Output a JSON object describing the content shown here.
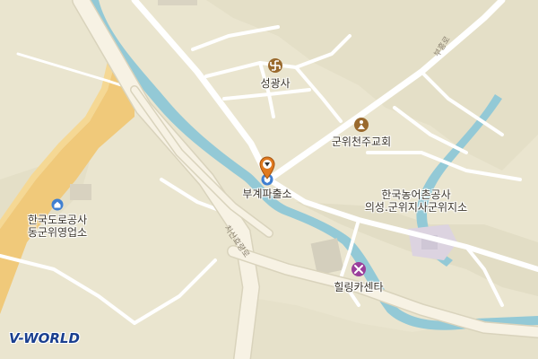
{
  "map": {
    "brand": "V-WORLD",
    "colors": {
      "land": "#eae5cf",
      "land_alt": "#e5e0c8",
      "road": "#ffffff",
      "road_edge": "#d9d3bc",
      "major_road": "#f6f1e3",
      "expressway": "#f0c56a",
      "river": "#93c9d6",
      "hill": "#ddd8c0",
      "building": "#d6d1c1",
      "facility_area": "#d9d2e2"
    },
    "places": [
      {
        "label": "성광사",
        "icon": "buddhist-temple-icon"
      },
      {
        "label": "군위천주교회",
        "icon": "church-icon"
      },
      {
        "label": "부계파출소",
        "icon": "police-station-icon",
        "selected": true
      },
      {
        "label": "한국농어촌공사\n의성.군위지사군위지소",
        "icon": ""
      },
      {
        "label": "한국도로공사\n동군위영업소",
        "icon": "office-icon"
      },
      {
        "label": "힐링카센타",
        "icon": "car-repair-icon"
      }
    ],
    "roads": [
      {
        "label": "부흥로"
      },
      {
        "label": "치산효령로"
      }
    ],
    "marker": {
      "icon": "location-pin-icon"
    }
  }
}
